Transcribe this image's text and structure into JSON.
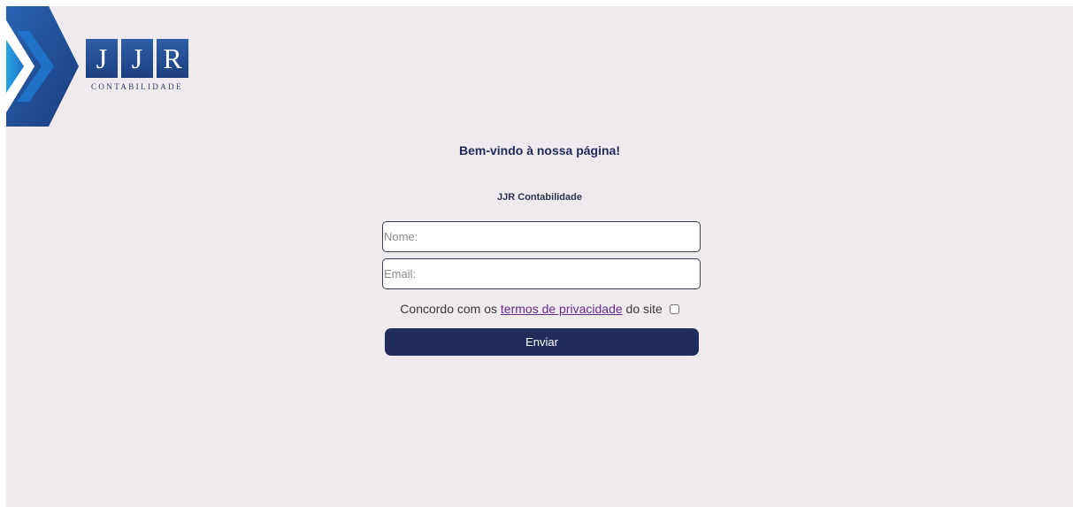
{
  "logo": {
    "letters": [
      "J",
      "J",
      "R"
    ],
    "subtitle": "CONTABILIDADE"
  },
  "welcome": "Bem-vindo à nossa página!",
  "company": "JJR Contabilidade",
  "form": {
    "name_placeholder": "Nome:",
    "email_placeholder": "Email:",
    "consent_before": "Concordo com os ",
    "consent_link": "termos de privacidade",
    "consent_after": " do site",
    "submit_label": "Enviar"
  },
  "colors": {
    "background": "#efeaee",
    "primary": "#202d5c",
    "link": "#6a2a8a",
    "logo_blue": "#2d5fa8"
  }
}
